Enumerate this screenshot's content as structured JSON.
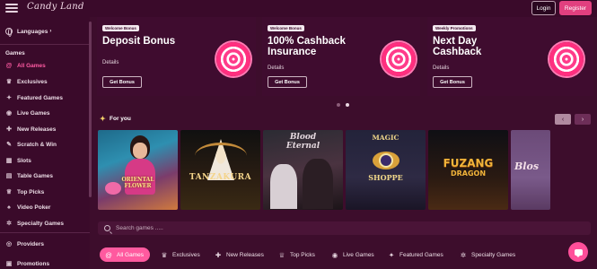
{
  "brand": {
    "logo_text": "Candy Land"
  },
  "header": {
    "login_label": "Login",
    "register_label": "Register"
  },
  "sidebar": {
    "languages_label": "Languages",
    "games_title": "Games",
    "items": [
      {
        "label": "All Games",
        "icon": "spiral-icon",
        "active": true
      },
      {
        "label": "Exclusives",
        "icon": "crown-icon"
      },
      {
        "label": "Featured Games",
        "icon": "star-icon"
      },
      {
        "label": "Live Games",
        "icon": "live-icon"
      },
      {
        "label": "New Releases",
        "icon": "new-icon"
      },
      {
        "label": "Scratch & Win",
        "icon": "scratch-icon"
      },
      {
        "label": "Slots",
        "icon": "slots-icon"
      },
      {
        "label": "Table Games",
        "icon": "table-icon"
      },
      {
        "label": "Top Picks",
        "icon": "trophy-icon"
      },
      {
        "label": "Video Poker",
        "icon": "cards-icon"
      },
      {
        "label": "Specialty Games",
        "icon": "gear-icon"
      }
    ],
    "providers_label": "Providers",
    "promotions_label": "Promotions"
  },
  "promos": [
    {
      "tag": "Welcome Bonus",
      "title": "Deposit Bonus",
      "details": "Details",
      "button": "Get Bonus"
    },
    {
      "tag": "Welcome Bonus",
      "title": "100% Cashback Insurance",
      "details": "Details",
      "button": "Get Bonus"
    },
    {
      "tag": "Weekly Promotions",
      "title": "Next Day Cashback",
      "details": "Details",
      "button": "Get Bonus"
    }
  ],
  "for_you": {
    "title": "For you",
    "prev": "‹",
    "next": "›"
  },
  "games": [
    {
      "name": "Oriental Flower",
      "label_lines": [
        "ORIENTAL",
        "FLOWER"
      ]
    },
    {
      "name": "Tanzakura",
      "label_lines": [
        "TANZAKURA"
      ]
    },
    {
      "name": "Blood Eternal",
      "label_lines": [
        "Blood",
        "Eternal"
      ]
    },
    {
      "name": "Magic Shoppe",
      "label_lines": [
        "MAGIC",
        "SHOPPE"
      ]
    },
    {
      "name": "Fuzang Dragon",
      "label_lines": [
        "FUZANG",
        "DRAGON"
      ]
    },
    {
      "name": "Blossom",
      "label_lines": [
        "Blos"
      ]
    }
  ],
  "search": {
    "placeholder": "Search games ....."
  },
  "tabs": [
    {
      "label": "All Games",
      "icon": "spiral-icon",
      "active": true
    },
    {
      "label": "Exclusives",
      "icon": "crown-icon"
    },
    {
      "label": "New Releases",
      "icon": "new-icon"
    },
    {
      "label": "Top Picks",
      "icon": "trophy-icon"
    },
    {
      "label": "Live Games",
      "icon": "live-icon"
    },
    {
      "label": "Featured Games",
      "icon": "star-icon"
    },
    {
      "label": "Specialty Games",
      "icon": "gear-icon"
    }
  ],
  "colors": {
    "accent": "#ff5a9f",
    "background": "#3d0d2c",
    "sidebar": "#3a0a2a"
  }
}
